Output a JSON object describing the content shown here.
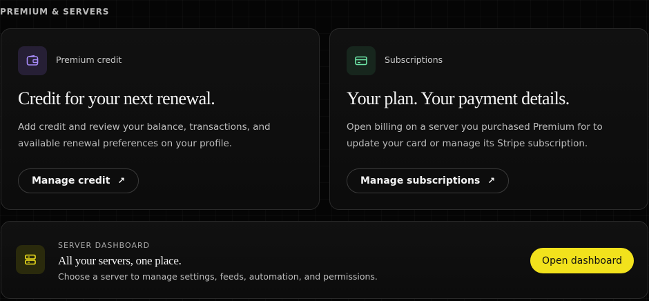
{
  "section_label": "PREMIUM & SERVERS",
  "cards": {
    "credit": {
      "icon": "wallet-icon",
      "kicker": "Premium credit",
      "title": "Credit for your next renewal.",
      "description": "Add credit and review your balance, transactions, and available renewal preferences on your profile.",
      "button_label": "Manage credit",
      "button_icon": "external-arrow-icon",
      "accent": "#a78bfa"
    },
    "subscriptions": {
      "icon": "credit-card-icon",
      "kicker": "Subscriptions",
      "title": "Your plan. Your payment details.",
      "description": "Open billing on a server you purchased Premium for to update your card or manage its Stripe subscription.",
      "button_label": "Manage subscriptions",
      "button_icon": "external-arrow-icon",
      "accent": "#6ee7a8"
    }
  },
  "dashboard": {
    "icon": "server-icon",
    "kicker": "SERVER DASHBOARD",
    "title": "All your servers, one place.",
    "description": "Choose a server to manage settings, feeds, automation, and permissions.",
    "button_label": "Open dashboard",
    "accent": "#f2e21c"
  }
}
